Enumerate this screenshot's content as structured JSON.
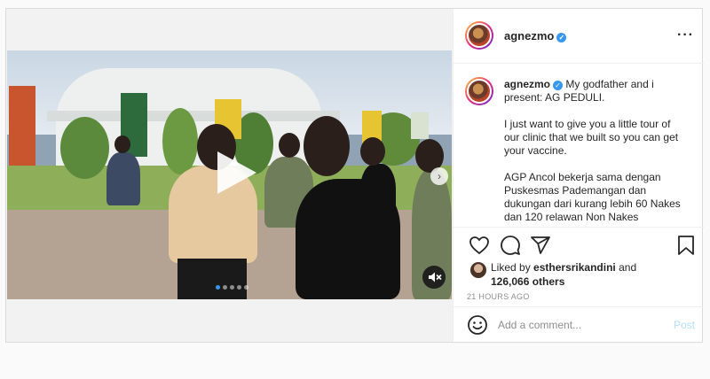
{
  "post": {
    "author": "agnezmo",
    "verified_mark": "✓",
    "more_icon": "more-horizontal-icon",
    "media": {
      "type": "video",
      "slide_count": 5,
      "active_slide": 1,
      "play_icon": "play-icon",
      "next_icon": "chevron-right-icon",
      "next_glyph": "›",
      "mute_icon": "mute-icon"
    },
    "caption": {
      "username": "agnezmo",
      "line1": "My godfather and i present: AG PEDULI.",
      "line2": "I just want to give you a little tour of our clinic that we built so you can get your vaccine.",
      "line3": "AGP Ancol bekerja sama dengan Puskesmas Pademangan dan dukungan dari kurang lebih 60 Nakes dan 120 relawan Non Nakes"
    },
    "actions": {
      "like_icon": "heart-icon",
      "comment_icon": "comment-icon",
      "share_icon": "send-icon",
      "save_icon": "bookmark-icon"
    },
    "likes": {
      "prefix": "Liked by",
      "user": "esthersrikandini",
      "and": "and",
      "count": "126,066 others"
    },
    "timestamp": "21 HOURS AGO",
    "comment": {
      "emoji_icon": "smile-icon",
      "placeholder": "Add a comment...",
      "post_label": "Post"
    }
  },
  "colors": {
    "accent": "#3897f0",
    "post_disabled": "#b2dffc",
    "border": "#dbdbdb",
    "background": "#fafafa"
  }
}
